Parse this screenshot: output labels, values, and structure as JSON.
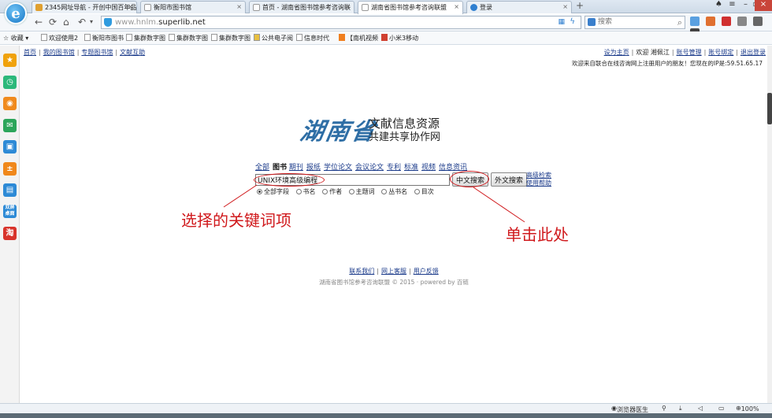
{
  "browser": {
    "tabs": [
      {
        "label": "2345网址导航 - 开创中国百年品",
        "color": "#e0a030"
      },
      {
        "label": "衡阳市图书馆",
        "color": "#ffffff"
      },
      {
        "label": "首页 - 湖南省图书馆参考咨询联",
        "color": "#ffffff"
      },
      {
        "label": "湖南省图书馆参考咨询联盟",
        "color": "#ffffff"
      },
      {
        "label": "登录",
        "color": "#2f7fd0"
      }
    ],
    "url_prefix": "www.hnlm.",
    "url_domain": "superlib.net",
    "search_placeholder": "搜索",
    "favorites_label": "收藏",
    "favorites": [
      "欢迎使用2",
      "衡阳市图书",
      "集群数字图",
      "集群数字图",
      "集群数字图",
      "公共电子阅",
      "信息时代",
      "【南机视频",
      "小米3移动"
    ],
    "status_text": "浏览器医生",
    "zoom": "100%"
  },
  "page": {
    "top_links": [
      "首页",
      "我的图书馆",
      "专题图书馆",
      "文献互助"
    ],
    "user_links": {
      "set_home": "设为主页",
      "welcome_user": "欢迎 湘佩江",
      "account_mgmt": "账号管理",
      "account_bind": "账号绑定",
      "logout": "退出登录"
    },
    "welcome_message": "欢迎来自联合在线咨询网上注册用户的朋友！您现在的IP是:59.51.65.17",
    "brand_calligraphy": "湖南省",
    "brand_line1": "文献信息资源",
    "brand_line2": "共建共享协作网",
    "categories": [
      "全部",
      "图书",
      "期刊",
      "报纸",
      "学位论文",
      "会议论文",
      "专利",
      "标准",
      "视频",
      "信息资讯"
    ],
    "active_category": "图书",
    "search_value": "UNIX环境高级编程",
    "btn_chinese_search": "中文搜索",
    "btn_foreign_search": "外文搜索",
    "advanced_search": "高级检索",
    "help": "使用帮助",
    "field_options": [
      "全部字段",
      "书名",
      "作者",
      "主题词",
      "丛书名",
      "目次"
    ],
    "annotation_left": "选择的关键词项",
    "annotation_right": "单击此处",
    "footer_links": [
      "联系我们",
      "网上客服",
      "用户反馈"
    ],
    "copyright": "湖南省图书馆参考咨询联盟 © 2015 · powered by 百链"
  },
  "sidebar_icons": [
    "star-icon",
    "clock-icon",
    "weibo-icon",
    "wechat-icon",
    "screen-icon",
    "calculator-icon",
    "notes-icon",
    "dual-desktop-icon",
    "app-icon"
  ],
  "sidebar_labels": [
    "★",
    "◷",
    "◉",
    "✉",
    "▣",
    "±",
    "▤",
    "双屏\n桌面",
    "淘"
  ],
  "sidebar_colors": [
    "#f0a20c",
    "#2cb87a",
    "#f08a1d",
    "#2ca55a",
    "#2d8ad6",
    "#f0881b",
    "#2d8ad6",
    "#2d8ad6",
    "#d8332b"
  ]
}
